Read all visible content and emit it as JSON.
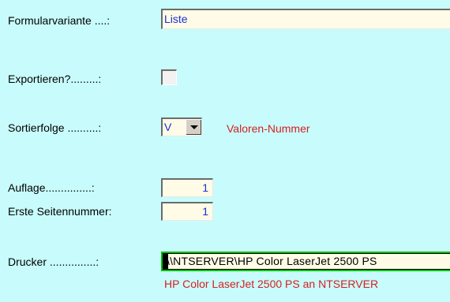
{
  "form": {
    "variant_label": "Formularvariante ....:",
    "variant_value": "Liste",
    "export_label": "Exportieren?.........:",
    "export_checked": false,
    "sort_label": "Sortierfolge ..........:",
    "sort_value": "V",
    "sort_description": "Valoren-Nummer",
    "auflage_label": "Auflage...............:",
    "auflage_value": "1",
    "seitennr_label": "Erste Seitennummer:",
    "seitennr_value": "1",
    "drucker_label": "Drucker ...............:",
    "drucker_value": "\\\\NTSERVER\\HP Color LaserJet 2500 PS",
    "drucker_description": "HP Color LaserJet 2500 PS an NTSERVER"
  },
  "colors": {
    "background": "#c8fcfc",
    "input_bg": "#fffbe6",
    "value_blue": "#1a2fd6",
    "desc_red": "#d62020",
    "focus_green": "#00c000"
  }
}
